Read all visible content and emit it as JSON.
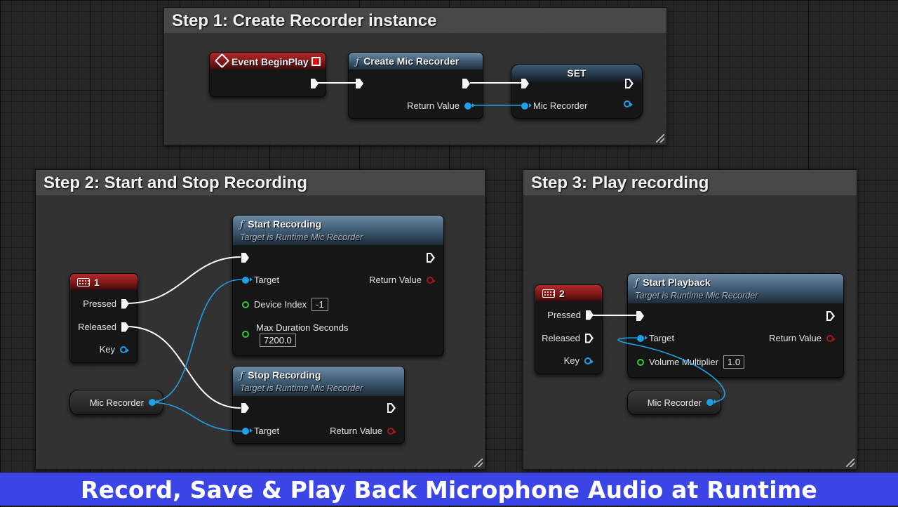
{
  "comments": {
    "step1": "Step 1: Create Recorder instance",
    "step2": "Step 2: Start and Stop Recording",
    "step3": "Step 3: Play recording"
  },
  "nodes": {
    "event_begin_play": {
      "title": "Event BeginPlay"
    },
    "create_mic_recorder": {
      "title": "Create Mic Recorder",
      "return_value": "Return Value"
    },
    "set_node": {
      "title": "SET",
      "mic_recorder": "Mic Recorder"
    },
    "key_1": {
      "title": "1",
      "pressed": "Pressed",
      "released": "Released",
      "key": "Key"
    },
    "start_recording": {
      "title": "Start Recording",
      "subtitle": "Target is Runtime Mic Recorder",
      "target": "Target",
      "return_value": "Return Value",
      "device_index_label": "Device Index",
      "device_index_value": "-1",
      "max_duration_label": "Max Duration Seconds",
      "max_duration_value": "7200.0"
    },
    "stop_recording": {
      "title": "Stop Recording",
      "subtitle": "Target is Runtime Mic Recorder",
      "target": "Target",
      "return_value": "Return Value"
    },
    "mic_recorder_var_1": {
      "label": "Mic Recorder"
    },
    "key_2": {
      "title": "2",
      "pressed": "Pressed",
      "released": "Released",
      "key": "Key"
    },
    "start_playback": {
      "title": "Start Playback",
      "subtitle": "Target is Runtime Mic Recorder",
      "target": "Target",
      "return_value": "Return Value",
      "volume_label": "Volume Multiplier",
      "volume_value": "1.0"
    },
    "mic_recorder_var_2": {
      "label": "Mic Recorder"
    }
  },
  "banner": {
    "text": "Record, Save & Play Back Microphone Audio at Runtime"
  },
  "colors": {
    "exec_wire": "#ffffff",
    "object_wire": "#1ea0e8",
    "banner_bg": "#3b45e6"
  }
}
